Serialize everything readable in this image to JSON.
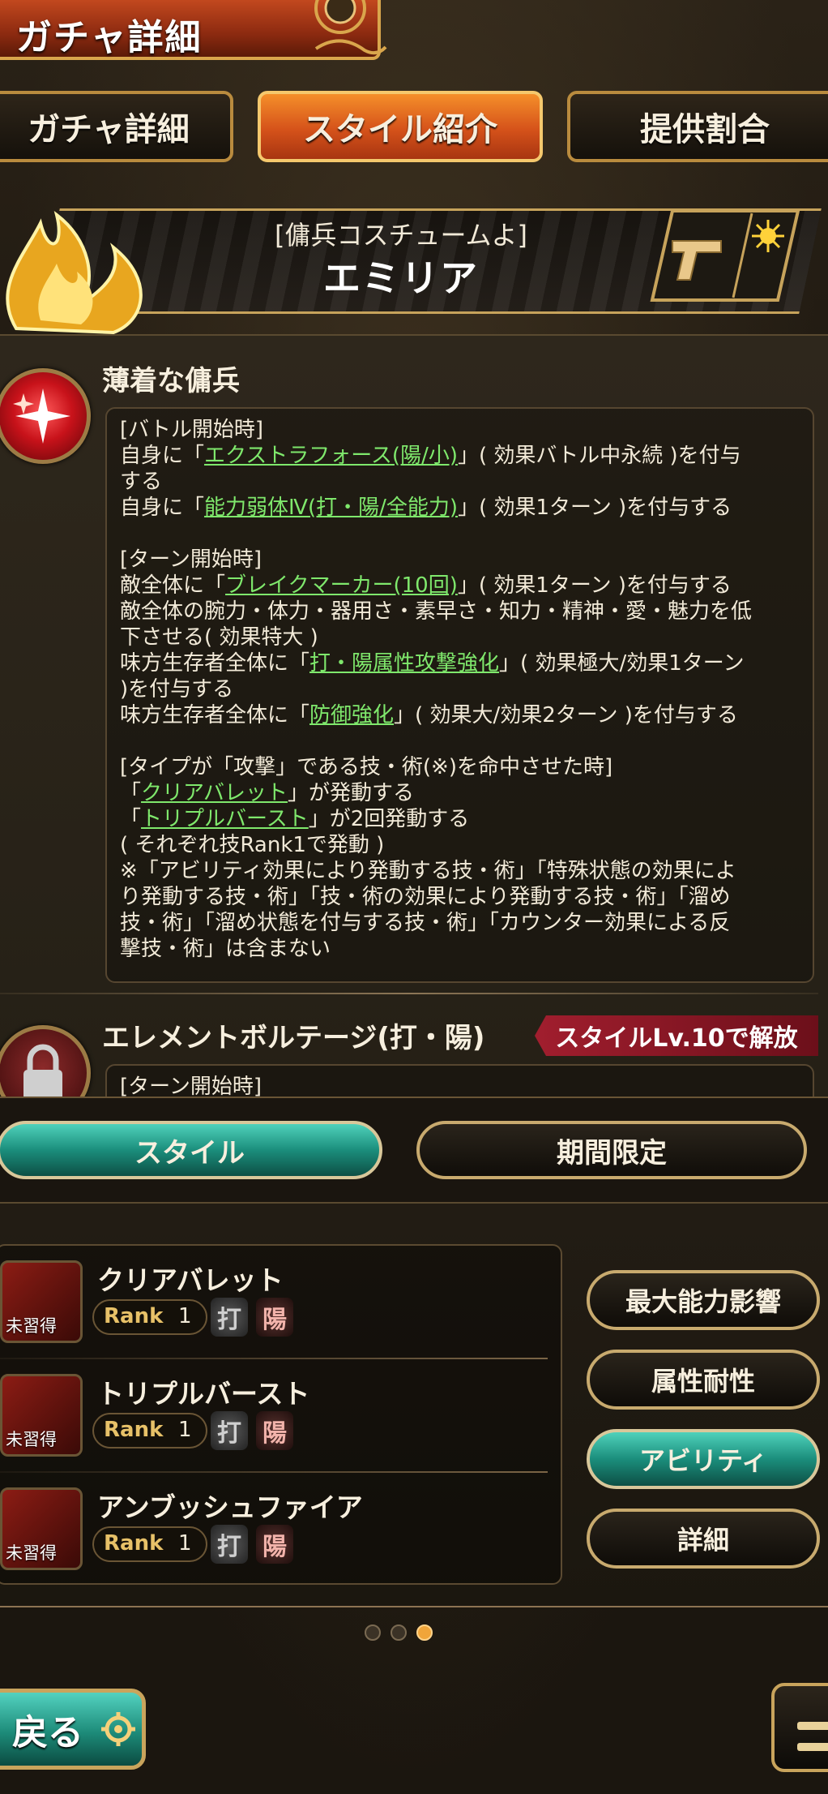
{
  "header": {
    "title": "ガチャ詳細"
  },
  "tabs": [
    {
      "label": "ガチャ詳細",
      "active": false
    },
    {
      "label": "スタイル紹介",
      "active": true
    },
    {
      "label": "提供割合",
      "active": false
    }
  ],
  "character": {
    "subtitle": "[傭兵コスチュームよ]",
    "name": "エミリア",
    "weapon_icon": "gun-icon",
    "element_icon": "sun-icon"
  },
  "abilities": [
    {
      "title": "薄着な傭兵",
      "icon": "sparkle-icon",
      "lines": [
        {
          "parts": [
            {
              "t": "[バトル開始時]"
            }
          ]
        },
        {
          "parts": [
            {
              "t": "自身に「"
            },
            {
              "t": "エクストラフォース(陽/小)",
              "hl": true
            },
            {
              "t": "」( 効果バトル中永続 )を付与"
            }
          ]
        },
        {
          "parts": [
            {
              "t": "する"
            }
          ]
        },
        {
          "parts": [
            {
              "t": "自身に「"
            },
            {
              "t": "能力弱体Ⅳ(打・陽/全能力)",
              "hl": true
            },
            {
              "t": "」( 効果1ターン )を付与する"
            }
          ]
        },
        {
          "gap": true
        },
        {
          "parts": [
            {
              "t": "[ターン開始時]"
            }
          ]
        },
        {
          "parts": [
            {
              "t": "敵全体に「"
            },
            {
              "t": "ブレイクマーカー(10回)",
              "hl": true
            },
            {
              "t": "」( 効果1ターン )を付与する"
            }
          ]
        },
        {
          "parts": [
            {
              "t": "敵全体の腕力・体力・器用さ・素早さ・知力・精神・愛・魅力を低"
            }
          ]
        },
        {
          "parts": [
            {
              "t": "下させる( 効果特大 )"
            }
          ]
        },
        {
          "parts": [
            {
              "t": "味方生存者全体に「"
            },
            {
              "t": "打・陽属性攻撃強化",
              "hl": true
            },
            {
              "t": "」( 効果極大/効果1ターン"
            }
          ]
        },
        {
          "parts": [
            {
              "t": ")を付与する"
            }
          ]
        },
        {
          "parts": [
            {
              "t": "味方生存者全体に「"
            },
            {
              "t": "防御強化",
              "hl": true
            },
            {
              "t": "」( 効果大/効果2ターン )を付与する"
            }
          ]
        },
        {
          "gap": true
        },
        {
          "parts": [
            {
              "t": "[タイプが「攻撃」である技・術(※)を命中させた時]"
            }
          ]
        },
        {
          "parts": [
            {
              "t": "「"
            },
            {
              "t": "クリアバレット",
              "hl": true
            },
            {
              "t": "」が発動する"
            }
          ]
        },
        {
          "parts": [
            {
              "t": "「"
            },
            {
              "t": "トリプルバースト",
              "hl": true
            },
            {
              "t": "」が2回発動する"
            }
          ]
        },
        {
          "parts": [
            {
              "t": "( それぞれ技Rank1で発動 )"
            }
          ]
        },
        {
          "parts": [
            {
              "t": "※「アビリティ効果により発動する技・術」「特殊状態の効果によ"
            }
          ]
        },
        {
          "parts": [
            {
              "t": "り発動する技・術」「技・術の効果により発動する技・術」「溜め"
            }
          ]
        },
        {
          "parts": [
            {
              "t": "技・術」「溜め状態を付与する技・術」「カウンター効果による反"
            }
          ]
        },
        {
          "parts": [
            {
              "t": "撃技・術」は含まない"
            }
          ]
        }
      ]
    },
    {
      "title": "エレメントボルテージ(打・陽)",
      "icon": "lock-icon",
      "unlock_label": "スタイルLv.10で解放",
      "first_line": "[ターン開始時]"
    }
  ],
  "mode_buttons": [
    {
      "label": "スタイル",
      "active": true
    },
    {
      "label": "期間限定",
      "active": false
    }
  ],
  "skills": [
    {
      "name": "クリアバレット",
      "status": "未習得",
      "rank_label": "Rank",
      "rank": "1",
      "attr1": "打",
      "attr2": "陽"
    },
    {
      "name": "トリプルバースト",
      "status": "未習得",
      "rank_label": "Rank",
      "rank": "1",
      "attr1": "打",
      "attr2": "陽"
    },
    {
      "name": "アンブッシュファイア",
      "status": "未習得",
      "rank_label": "Rank",
      "rank": "1",
      "attr1": "打",
      "attr2": "陽"
    }
  ],
  "side_buttons": [
    {
      "label": "最大能力影響",
      "active": false
    },
    {
      "label": "属性耐性",
      "active": false
    },
    {
      "label": "アビリティ",
      "active": true
    },
    {
      "label": "詳細",
      "active": false
    }
  ],
  "pager": {
    "count": 3,
    "current": 3
  },
  "footer": {
    "back_label": "戻る"
  },
  "colors": {
    "highlight": "#7fe86c",
    "active_tab": "#e2641f",
    "active_teal": "#1b8e7c",
    "unlock_badge": "#a11e2e"
  }
}
